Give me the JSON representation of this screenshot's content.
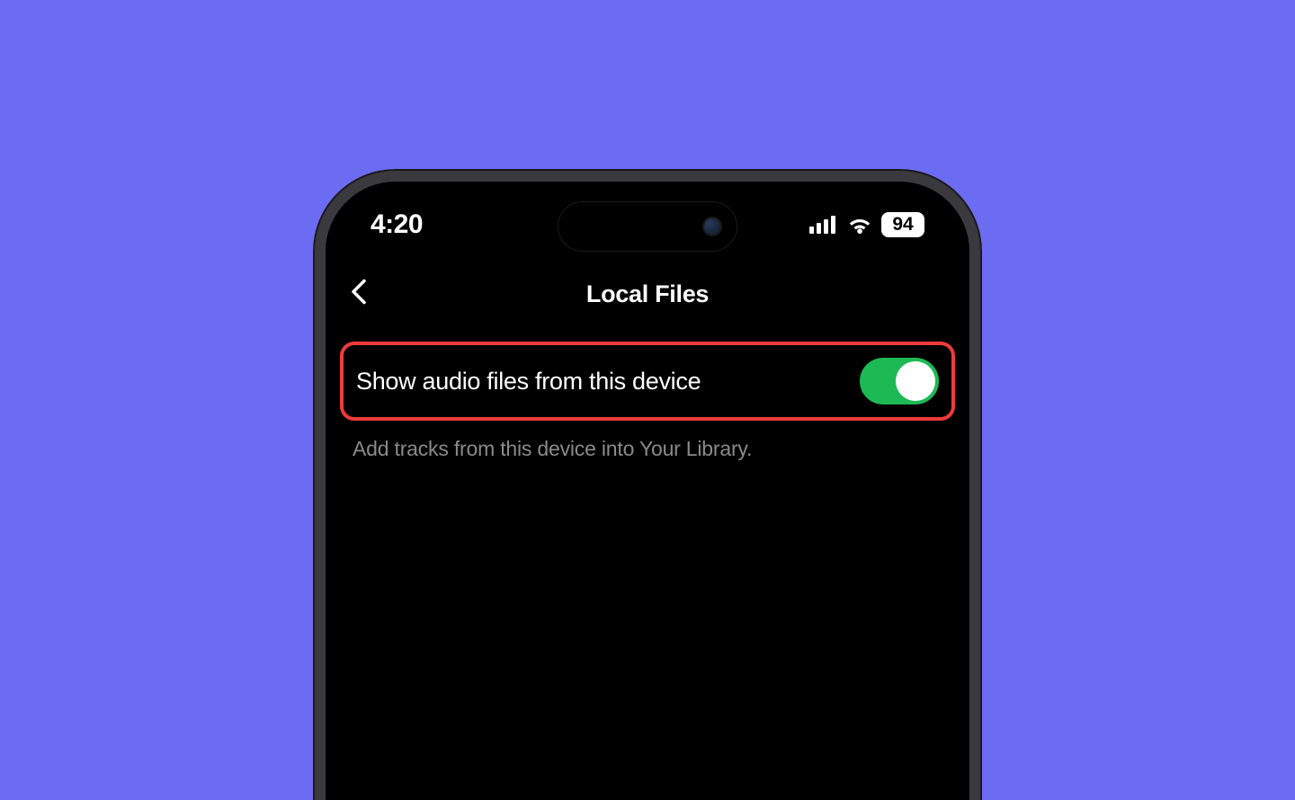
{
  "statusBar": {
    "time": "4:20",
    "battery": "94"
  },
  "header": {
    "title": "Local Files"
  },
  "setting": {
    "label": "Show audio files from this device",
    "description": "Add tracks from this device into Your Library.",
    "toggleOn": true
  }
}
